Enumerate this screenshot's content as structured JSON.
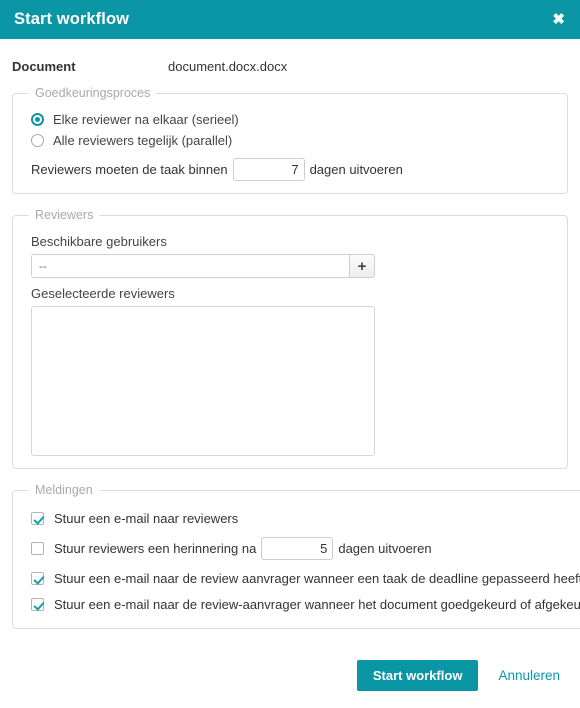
{
  "dialog": {
    "title": "Start workflow",
    "close_icon": "close-icon",
    "accent_color": "#0b96a6"
  },
  "document_row": {
    "label": "Document",
    "value": "document.docx.docx"
  },
  "approval_process": {
    "legend": "Goedkeuringsproces",
    "options": [
      {
        "label": "Elke reviewer na elkaar (serieel)",
        "selected": true
      },
      {
        "label": "Alle reviewers tegelijk (parallel)",
        "selected": false
      }
    ],
    "deadline": {
      "prefix": "Reviewers moeten de taak binnen",
      "value": "7",
      "suffix": "dagen uitvoeren"
    }
  },
  "reviewers": {
    "legend": "Reviewers",
    "available_label": "Beschikbare gebruikers",
    "available_value": "--",
    "add_icon": "plus-icon",
    "selected_label": "Geselecteerde reviewers",
    "selected_items": []
  },
  "notifications": {
    "legend": "Meldingen",
    "items": [
      {
        "label": "Stuur een e-mail naar reviewers",
        "checked": true
      },
      {
        "label": "Stuur reviewers een herinnering na",
        "checked": false,
        "value": "5",
        "suffix": "dagen uitvoeren"
      },
      {
        "label": "Stuur een e-mail naar de review aanvrager wanneer een taak de deadline gepasseerd heeft",
        "checked": true
      },
      {
        "label": "Stuur een e-mail naar de review-aanvrager wanneer het document goedgekeurd of afgekeurd is",
        "checked": true
      }
    ]
  },
  "footer": {
    "submit_label": "Start workflow",
    "cancel_label": "Annuleren"
  }
}
